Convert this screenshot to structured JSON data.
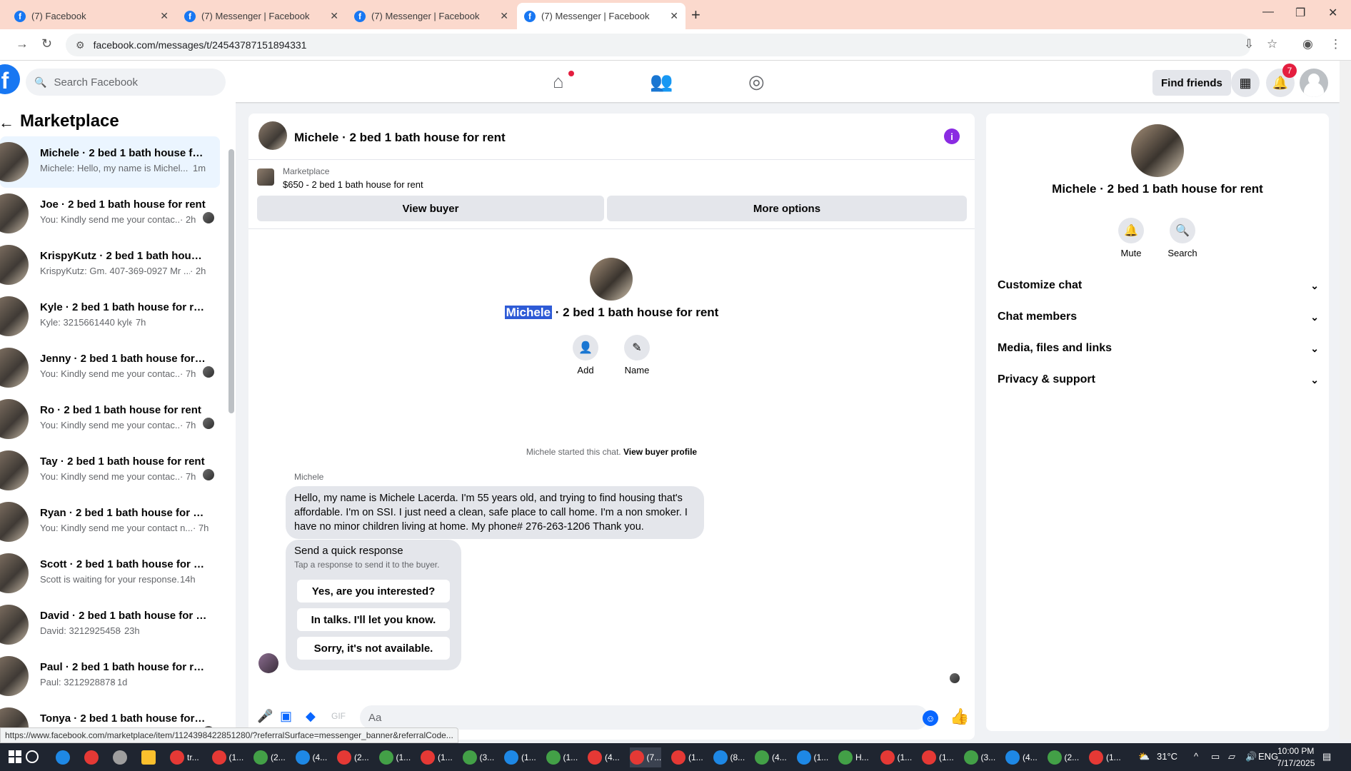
{
  "browser": {
    "tabs": [
      {
        "title": "(7) Facebook",
        "active": false
      },
      {
        "title": "(7) Messenger | Facebook",
        "active": false
      },
      {
        "title": "(7) Messenger | Facebook",
        "active": false
      },
      {
        "title": "(7) Messenger | Facebook",
        "active": true
      }
    ],
    "url": "facebook.com/messages/t/24543787151894331",
    "status_url": "https://www.facebook.com/marketplace/item/1124398422851280/?referralSurface=messenger_banner&referralCode..."
  },
  "fb_header": {
    "search_placeholder": "Search Facebook",
    "find_friends": "Find friends",
    "notification_count": "7"
  },
  "sidebar": {
    "title": "Marketplace",
    "conversations": [
      {
        "name": "Michele · 2 bed 1 bath house for rent",
        "preview": "Michele: Hello, my name is Michel...",
        "time": "1m",
        "selected": true
      },
      {
        "name": "Joe · 2 bed 1 bath house for rent",
        "preview": "You: Kindly send me your contac...",
        "time": "· 2h"
      },
      {
        "name": "KrispyKutz · 2 bed 1 bath house for rent",
        "preview": "KrispyKutz: Gm. 407-369-0927 Mr ...",
        "time": "· 2h"
      },
      {
        "name": "Kyle · 2 bed 1 bath house for rent",
        "preview": "Kyle: 3215661440 kyle",
        "time": "· 7h"
      },
      {
        "name": "Jenny · 2 bed 1 bath house for rent",
        "preview": "You: Kindly send me your contac...",
        "time": "· 7h"
      },
      {
        "name": "Ro · 2 bed 1 bath house for rent",
        "preview": "You: Kindly send me your contac...",
        "time": "· 7h"
      },
      {
        "name": "Tay · 2 bed 1 bath house for rent",
        "preview": "You: Kindly send me your contac...",
        "time": "· 7h"
      },
      {
        "name": "Ryan · 2 bed 1 bath house for rent",
        "preview": "You: Kindly send me your contact n...",
        "time": "· 7h"
      },
      {
        "name": "Scott · 2 bed 1 bath house for rent",
        "preview": "Scott is waiting for your response.",
        "time": "· 14h"
      },
      {
        "name": "David · 2 bed 1 bath house for rent",
        "preview": "David: 3212925458",
        "time": "· 23h"
      },
      {
        "name": "Paul · 2 bed 1 bath house for rent",
        "preview": "Paul: 3212928878",
        "time": "· 1d"
      },
      {
        "name": "Tonya · 2 bed 1 bath house for rent",
        "preview": "",
        "time": ""
      }
    ]
  },
  "chat": {
    "title": "Michele · 2 bed 1 bath house for rent",
    "listing_label": "Marketplace",
    "listing_price": "$650 - 2 bed 1 bath house for rent",
    "view_buyer": "View buyer",
    "more_options": "More options",
    "profile_name_highlight": "Michele",
    "profile_name_rest": " · 2 bed 1 bath house for rent",
    "add_label": "Add",
    "name_label": "Name",
    "started_text": "Michele started this chat. ",
    "view_buyer_profile": "View buyer profile",
    "sender": "Michele",
    "message": "Hello, my name is Michele Lacerda. I'm 55 years old, and trying to find housing that's affordable. I'm on SSI. I just need a clean, safe place to call home. I'm a non smoker. I have no minor children living at home. My phone# 276-263-1206 Thank you.",
    "quick_title": "Send a quick response",
    "quick_sub": "Tap a response to send it to the buyer.",
    "quick_responses": [
      "Yes, are you interested?",
      "In talks. I'll let you know.",
      "Sorry, it's not available."
    ],
    "composer_placeholder": "Aa"
  },
  "info_panel": {
    "title": "Michele · 2 bed 1 bath house for rent",
    "mute": "Mute",
    "search": "Search",
    "sections": [
      "Customize chat",
      "Chat members",
      "Media, files and links",
      "Privacy & support"
    ]
  },
  "taskbar": {
    "apps": [
      "tr...",
      "(1...",
      "(2...",
      "(4...",
      "(2...",
      "(1...",
      "(1...",
      "(3...",
      "(1...",
      "(1...",
      "(4...",
      "(7...",
      "(1...",
      "(8...",
      "(4...",
      "(1...",
      "H...",
      "(1...",
      "(1...",
      "(3...",
      "(4...",
      "(2...",
      "(1..."
    ],
    "weather": "31°C",
    "lang": "ENG",
    "time": "10:00 PM",
    "date": "7/17/2025"
  }
}
